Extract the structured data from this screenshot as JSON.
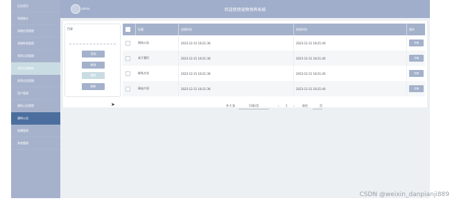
{
  "sidebar": {
    "items": [
      {
        "label": "后台首页"
      },
      {
        "label": "系统统计"
      },
      {
        "label": "宠物信息管理"
      },
      {
        "label": "宠物种类管理"
      },
      {
        "label": "领养记录管理"
      },
      {
        "label": "领养记录审核"
      },
      {
        "label": "寄养信息管理"
      },
      {
        "label": "用户管理"
      },
      {
        "label": "通知公告管理"
      },
      {
        "label": "通知公告"
      },
      {
        "label": "轮播管理"
      },
      {
        "label": "系统管理"
      }
    ]
  },
  "header": {
    "logo_text": "admin",
    "title": "欢迎使用宠物领养系统"
  },
  "tree": {
    "label": "目录",
    "buttons": [
      "添加",
      "修改",
      "删除",
      "刷新"
    ]
  },
  "table": {
    "headers": {
      "title": "标题",
      "created": "创建时间",
      "updated": "修改时间",
      "op": "操作"
    },
    "rows": [
      {
        "title": "网站公告",
        "created": "2023-12-31 18:21:36",
        "updated": "2023-12-31 18:21:40",
        "op": "详情"
      },
      {
        "title": "关于我们",
        "created": "2023-12-31 18:21:36",
        "updated": "2023-12-31 18:21:40",
        "op": "详情"
      },
      {
        "title": "联系方式",
        "created": "2023-12-31 18:21:36",
        "updated": "2023-12-31 18:21:40",
        "op": "详情"
      },
      {
        "title": "网站介绍",
        "created": "2023-12-31 18:21:36",
        "updated": "2023-12-31 18:21:40",
        "op": "详情"
      }
    ]
  },
  "pagination": {
    "total": "共 4 条",
    "page_size": "10条/页",
    "prev": "‹",
    "current": "1",
    "next": "›",
    "goto_label": "前往",
    "page_unit": "页"
  },
  "watermark": "CSDN @weixin_danpianji889",
  "colors": {
    "sidebar": "#a6b2cc",
    "active": "#4b6e9e",
    "accent": "#a3b1cb"
  }
}
